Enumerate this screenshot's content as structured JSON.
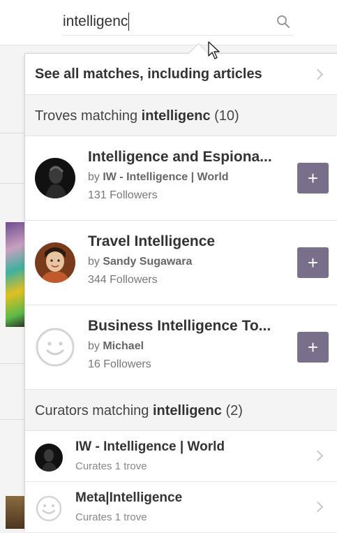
{
  "search": {
    "value": "intelligenc",
    "icon": "search-icon"
  },
  "dropdown": {
    "see_all_label": "See all matches, including articles",
    "troves_header": {
      "prefix": "Troves matching ",
      "term": "intelligenc",
      "count": "(10)"
    },
    "troves": [
      {
        "title": "Intelligence and Espiona...",
        "by_prefix": "by ",
        "owner": "IW - Intelligence | World",
        "followers": "131 Followers",
        "follow_label": "+",
        "avatar": "dark-portrait-avatar"
      },
      {
        "title": "Travel Intelligence",
        "by_prefix": "by ",
        "owner": "Sandy Sugawara",
        "followers": "344 Followers",
        "follow_label": "+",
        "avatar": "user-photo-avatar"
      },
      {
        "title": "Business Intelligence To...",
        "by_prefix": "by ",
        "owner": "Michael",
        "followers": "16 Followers",
        "follow_label": "+",
        "avatar": "smiley-placeholder-avatar"
      }
    ],
    "curators_header": {
      "prefix": "Curators matching ",
      "term": "intelligenc",
      "count": "(2)"
    },
    "curators": [
      {
        "name": "IW - Intelligence | World",
        "sub": "Curates 1 trove",
        "avatar": "dark-portrait-avatar"
      },
      {
        "name": "Meta|Intelligence",
        "sub": "Curates 1 trove",
        "avatar": "smiley-placeholder-avatar"
      }
    ]
  },
  "colors": {
    "follow_button": "#7a6f8b",
    "section_header_bg": "#f4f4f4"
  }
}
